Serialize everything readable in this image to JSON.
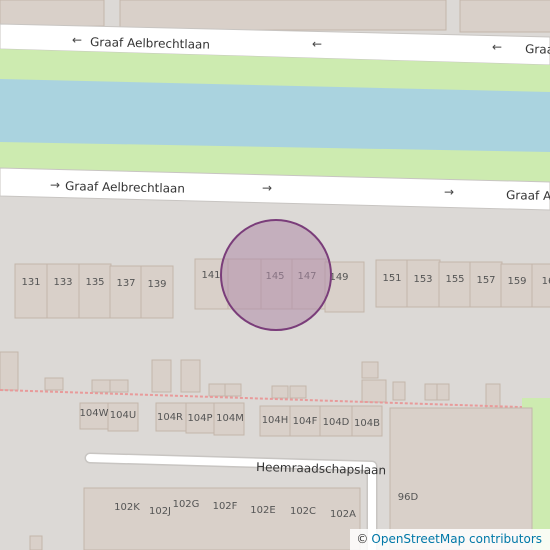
{
  "map": {
    "streets": {
      "north": "Graaf Aelbrechtlaan",
      "north_right": "Graaf Aelbrechtlaan",
      "south": "Graaf Aelbrechtlaan",
      "south_right": "Graaf Ae",
      "lower": "Heemraadschapslaan"
    },
    "houses_row1": [
      "131",
      "133",
      "135",
      "137",
      "139",
      "141",
      "145",
      "147",
      "149",
      "151",
      "153",
      "155",
      "157",
      "159",
      "16"
    ],
    "houses_row2": [
      "104W",
      "104U",
      "104R",
      "104P",
      "104M",
      "104H",
      "104F",
      "104D",
      "104B"
    ],
    "houses_row3": [
      "102K",
      "102J",
      "102G",
      "102F",
      "102E",
      "102C",
      "102A"
    ],
    "house_96d": "96D",
    "colors": {
      "background": "#dcd9d6",
      "road": "#ffffff",
      "road_edge": "#c8c5c2",
      "water": "#aad3df",
      "grass": "#cdebb0",
      "building": "#d9d0c9",
      "building_edge": "#c4b6ab",
      "label": "#555555",
      "marker_fill": "#b08caa",
      "marker_stroke": "#7a3d7a",
      "boundary": "#e89a9a"
    }
  },
  "attribution": {
    "symbol": "©",
    "text": "OpenStreetMap contributors"
  }
}
